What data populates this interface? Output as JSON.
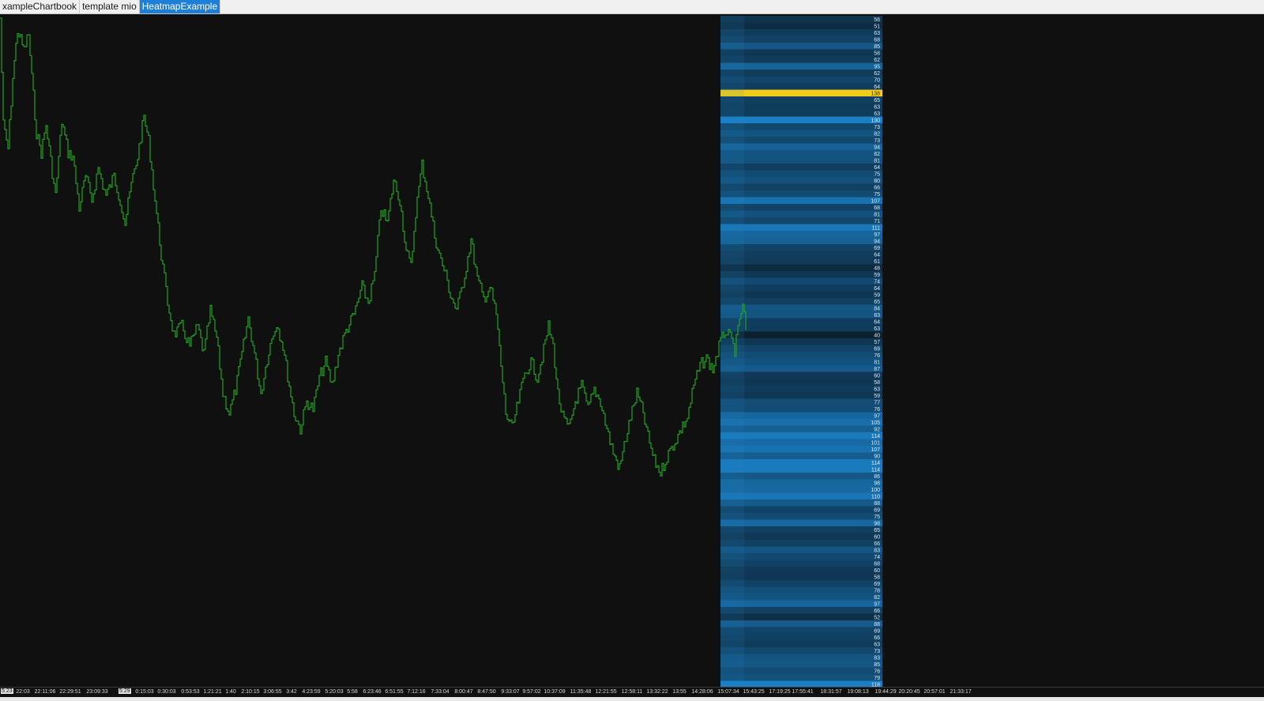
{
  "tabs": [
    {
      "label": "xampleChartbook",
      "active": false
    },
    {
      "label": "template mio",
      "active": false
    },
    {
      "label": "HeatmapExample",
      "active": true
    }
  ],
  "colors": {
    "background": "#101010",
    "price_line": "#1fa31f",
    "heatmap_low": "#0b1a26",
    "heatmap_high": "#1a7fc4",
    "highlight": "#f2cc18"
  },
  "heatmap": {
    "levels": [
      56,
      51,
      63,
      68,
      85,
      58,
      62,
      95,
      62,
      70,
      64,
      138,
      65,
      63,
      63,
      130,
      73,
      82,
      73,
      94,
      82,
      81,
      64,
      75,
      80,
      66,
      75,
      107,
      68,
      81,
      71,
      111,
      97,
      94,
      69,
      64,
      61,
      48,
      59,
      74,
      64,
      59,
      65,
      84,
      83,
      64,
      63,
      40,
      57,
      69,
      76,
      81,
      87,
      60,
      58,
      63,
      59,
      77,
      76,
      97,
      105,
      92,
      114,
      101,
      107,
      90,
      114,
      114,
      86,
      98,
      100,
      110,
      88,
      69,
      75,
      98,
      65,
      60,
      66,
      83,
      74,
      68,
      60,
      58,
      69,
      78,
      82,
      97,
      66,
      52,
      88,
      69,
      66,
      63,
      73,
      83,
      85,
      76,
      79,
      118
    ],
    "highlight_value": "138"
  },
  "time_axis": {
    "markers": [
      "5:23",
      "5:29"
    ],
    "labels": [
      "22:03",
      "22:11:06",
      "22:29:51",
      "23:09:33",
      "0:15:03",
      "0:30:03",
      "0:53:53",
      "1:21:21",
      "1:40",
      "2:10:15",
      "3:06:55",
      "3:42",
      "4:23:59",
      "5:20:03",
      "5:58",
      "6:23:46",
      "6:51:55",
      "7:12:16",
      "7:33:04",
      "8:00:47",
      "8:47:50",
      "9:33:07",
      "9:57:02",
      "10:37:09",
      "11:35:48",
      "12:21:55",
      "12:58:11",
      "13:32:22",
      "13:55",
      "14:28:06",
      "15:07:34",
      "15:43:25",
      "17:19:25",
      "17:55:41",
      "18:31:57",
      "19:08:13",
      "19:44:29",
      "20:20:45",
      "20:57:01",
      "21:33:17"
    ]
  }
}
